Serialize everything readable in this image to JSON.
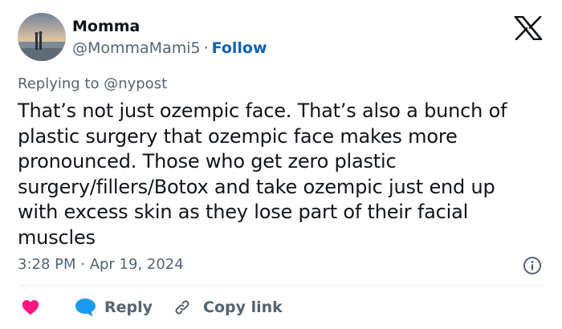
{
  "author": {
    "name": "Momma",
    "handle": "@MommaMami5",
    "separator": "·",
    "follow_label": "Follow"
  },
  "reply_context": {
    "text": "Replying to @nypost"
  },
  "tweet": {
    "text": "That’s not just ozempic face. That’s also a bunch of plastic surgery that ozempic face makes more pronounced. Those who get zero plastic surgery/fillers/Botox and take ozempic just end up with excess skin as they lose part of their facial muscles",
    "timestamp": "3:28 PM · Apr 19, 2024"
  },
  "actions": {
    "reply_label": "Reply",
    "copy_link_label": "Copy link"
  },
  "colors": {
    "text_primary": "#0f1419",
    "text_secondary": "#536471",
    "follow": "#0f62b3",
    "heart": "#f91880",
    "reply_icon": "#1d9bf0",
    "divider": "#e1e8ed"
  },
  "icons": {
    "brand": "x-logo-icon",
    "info": "info-icon",
    "like": "heart-icon",
    "reply": "reply-bubble-icon",
    "copy_link": "link-icon"
  }
}
